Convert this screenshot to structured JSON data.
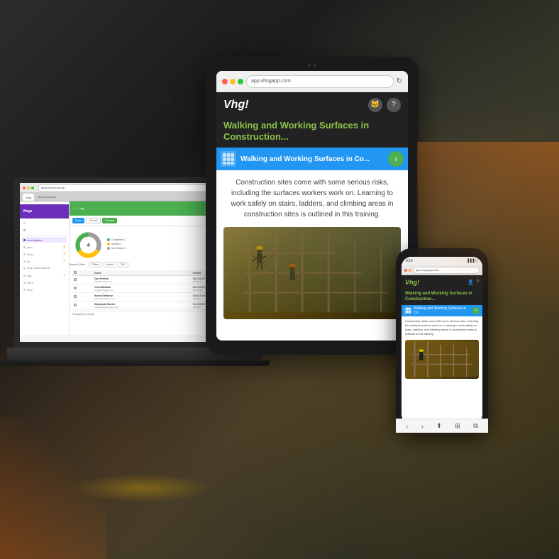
{
  "background": {
    "color": "#1a1a1a"
  },
  "tablet": {
    "browser_url": "app.vhngapp.com",
    "app_title": "Walking and Working Surfaces in Construction...",
    "logo": "Vhg!",
    "nav_title": "Walking and Working Surfaces in Co...",
    "description": "Construction sites come with some serious risks, including the surfaces workers work on. Learning to work safely on stairs, ladders, and climbing areas in construction sites is outlined in this training.",
    "camera_dots": 2
  },
  "laptop": {
    "browser_url": "https://myworkcmp...",
    "tabs": [
      "Ving",
      "Blog Resources"
    ],
    "app_name": "Vings",
    "title": "Investigation",
    "actions": {
      "share": "Share",
      "recruit": "Recruit",
      "preview": "Preview"
    },
    "chart": {
      "total": 4,
      "completed": 2,
      "viewed": 1,
      "not_viewed": 1
    },
    "legend": {
      "completed": "Completed  2",
      "viewed": "Viewed  1",
      "not_viewed": "Not Viewed  1"
    },
    "table": {
      "columns": [
        "Name",
        "Invited"
      ],
      "rows": [
        {
          "name": "Dan Pedical",
          "email": "dan@virogapp.com",
          "date": "08/13/2020",
          "time": "11:23 AM"
        },
        {
          "name": "Chris Battisto",
          "email": "chris@virogapp.com",
          "date": "02/12/2020",
          "time": "10:51 AM"
        },
        {
          "name": "Karen Greberry",
          "email": "karen@virogapp.com",
          "date": "08/31/2019",
          "time": "2:34 PM"
        },
        {
          "name": "Stephanie Hunter",
          "email": "stephanie@virogapp.com",
          "date": "01/15/2020",
          "time": "9:00 AM"
        }
      ]
    },
    "footer": "Displaying 4 people"
  },
  "phone": {
    "browser_url": "app.vingzapp.com",
    "status": "8:16",
    "logo": "Vhg!",
    "title": "Walking and Working Surfaces in Construction...",
    "nav_title": "Walking and Working Surfaces in Co...",
    "description": "Construction sites come with some serious risks, including the surfaces workers work on. Learning to work safely on stairs, ladders, and climbing areas in construction sites is outlined in this training."
  },
  "colors": {
    "accent_green": "#8BC34A",
    "brand_purple": "#6c2eb9",
    "nav_blue": "#2196F3",
    "dark_bg": "#222222",
    "table_header_bg": "#f5f5f5",
    "completed_color": "#4CAF50",
    "viewed_color": "#FFC107",
    "not_viewed_color": "#9E9E9E"
  }
}
